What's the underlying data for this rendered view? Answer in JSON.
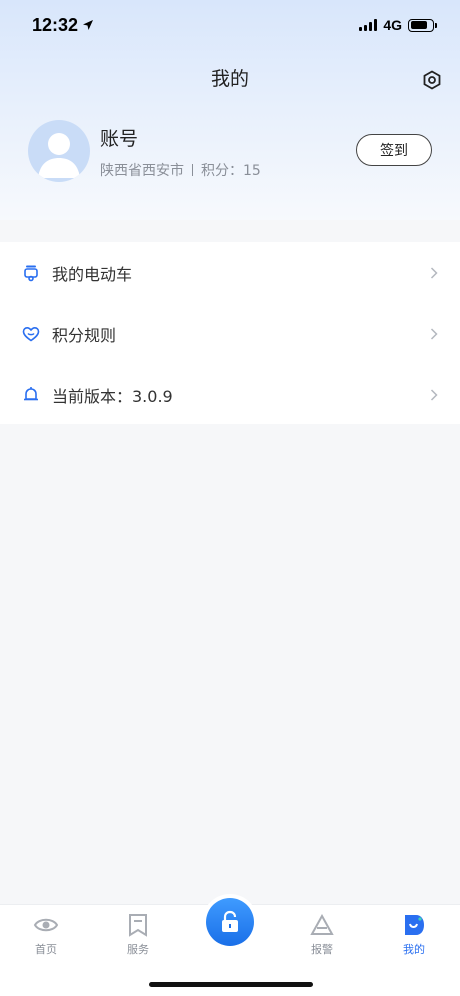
{
  "status_bar": {
    "time": "12:32",
    "network": "4G"
  },
  "header": {
    "title": "我的"
  },
  "profile": {
    "username": "账号",
    "location": "陕西省西安市",
    "points_label": "积分：15",
    "sign_in_label": "签到"
  },
  "menu": {
    "items": [
      {
        "label": "我的电动车",
        "icon": "scooter-icon"
      },
      {
        "label": "积分规则",
        "icon": "heart-icon"
      },
      {
        "label": "当前版本：3.0.9",
        "icon": "bell-icon"
      }
    ]
  },
  "tabbar": {
    "items": [
      {
        "label": "首页",
        "icon": "eye-icon"
      },
      {
        "label": "服务",
        "icon": "service-icon"
      },
      {
        "label": "报警",
        "icon": "alarm-icon"
      },
      {
        "label": "我的",
        "icon": "profile-icon"
      }
    ],
    "center_icon": "lock-icon"
  },
  "colors": {
    "accent": "#2a6ff0",
    "muted": "#8a8f98"
  }
}
